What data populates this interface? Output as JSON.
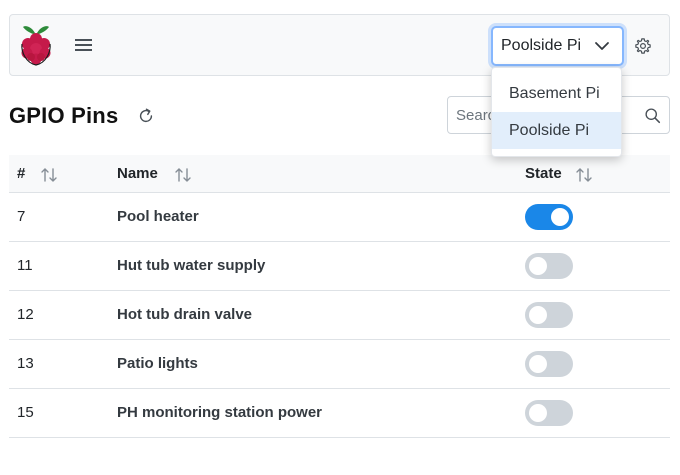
{
  "navbar": {
    "selected_device": "Poolside Pi",
    "device_options": [
      "Basement Pi",
      "Poolside Pi"
    ]
  },
  "page": {
    "title": "GPIO Pins"
  },
  "search": {
    "placeholder": "Search"
  },
  "table": {
    "headers": {
      "number": "#",
      "name": "Name",
      "state": "State"
    },
    "rows": [
      {
        "pin": "7",
        "name": "Pool heater",
        "state_on": true
      },
      {
        "pin": "11",
        "name": "Hut tub water supply",
        "state_on": false
      },
      {
        "pin": "12",
        "name": "Hot tub drain valve",
        "state_on": false
      },
      {
        "pin": "13",
        "name": "Patio lights",
        "state_on": false
      },
      {
        "pin": "15",
        "name": "PH monitoring station power",
        "state_on": false
      }
    ]
  },
  "colors": {
    "toggle_on": "#1a87e8",
    "toggle_off": "#ced4da",
    "raspberry": "#c51a4a",
    "leaf": "#2e8b3a"
  },
  "icons": [
    "raspberry-pi-logo",
    "hamburger-icon",
    "chevron-down-icon",
    "gear-icon",
    "refresh-icon",
    "search-icon",
    "sort-icon"
  ]
}
